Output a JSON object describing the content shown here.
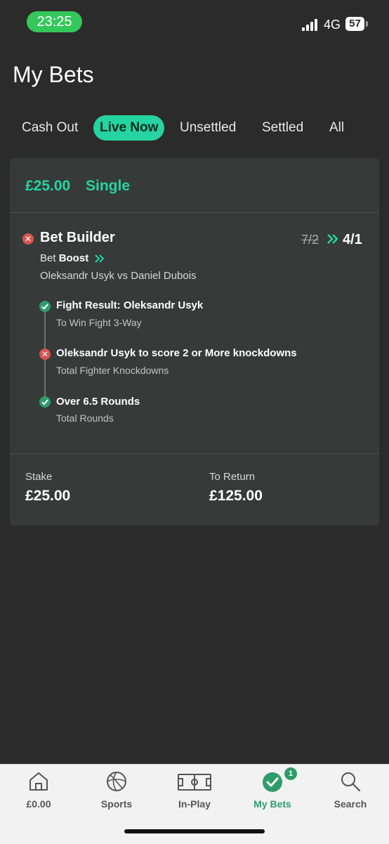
{
  "status_bar": {
    "time": "23:25",
    "network": "4G",
    "battery": "57"
  },
  "page_title": "My Bets",
  "tabs": [
    {
      "label": "Cash Out"
    },
    {
      "label": "Live Now",
      "active": true
    },
    {
      "label": "Unsettled"
    },
    {
      "label": "Settled"
    },
    {
      "label": "All"
    }
  ],
  "bet": {
    "amount": "£25.00",
    "type": "Single",
    "title": "Bet Builder",
    "odds_old": "7/2",
    "odds_new": "4/1",
    "boost_prefix": "Bet",
    "boost_word": "Boost",
    "event": "Oleksandr Usyk vs Daniel Dubois",
    "selections": [
      {
        "title": "Fight Result: Oleksandr Usyk",
        "market": "To Win Fight 3-Way",
        "status": "won"
      },
      {
        "title": "Oleksandr Usyk to score 2 or More knockdowns",
        "market": "Total Fighter Knockdowns",
        "status": "lost"
      },
      {
        "title": "Over 6.5 Rounds",
        "market": "Total Rounds",
        "status": "won"
      }
    ],
    "stake_label": "Stake",
    "stake_value": "£25.00",
    "return_label": "To Return",
    "return_value": "£125.00"
  },
  "bottom_nav": [
    {
      "label": "£0.00",
      "icon": "home-icon"
    },
    {
      "label": "Sports",
      "icon": "football-icon"
    },
    {
      "label": "In-Play",
      "icon": "pitch-icon"
    },
    {
      "label": "My Bets",
      "icon": "check-circle-icon",
      "active": true,
      "badge": "1"
    },
    {
      "label": "Search",
      "icon": "search-icon"
    }
  ],
  "colors": {
    "accent": "#25d4a1",
    "win": "#2f9d6b",
    "loss": "#d9534f",
    "background": "#2b2b2b",
    "card": "#363a38"
  }
}
